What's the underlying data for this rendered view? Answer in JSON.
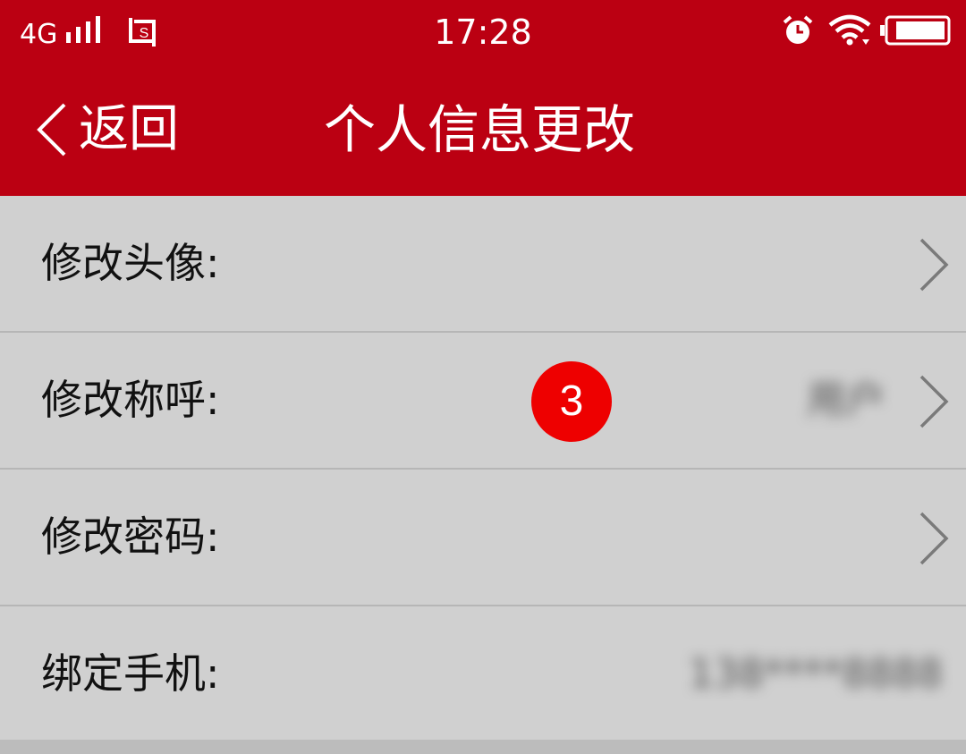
{
  "status_bar": {
    "network": "4G",
    "time": "17:28",
    "icons": [
      "signal-bars-icon",
      "screenshot-icon",
      "alarm-icon",
      "wifi-icon",
      "battery-icon"
    ]
  },
  "nav": {
    "back_label": "返回",
    "title": "个人信息更改"
  },
  "rows": [
    {
      "label": "修改头像:",
      "value": "",
      "has_chevron": true
    },
    {
      "label": "修改称呼:",
      "value": "用户",
      "value_blurred": true,
      "has_chevron": true
    },
    {
      "label": "修改密码:",
      "value": "",
      "has_chevron": true
    },
    {
      "label": "绑定手机:",
      "value": "138****8888",
      "value_blurred": true,
      "has_chevron": false
    }
  ],
  "step_badge": "3",
  "colors": {
    "header": "#bb0012",
    "list_background": "#d0d0d0",
    "divider": "#b6b6b6",
    "badge": "#ee0000"
  }
}
